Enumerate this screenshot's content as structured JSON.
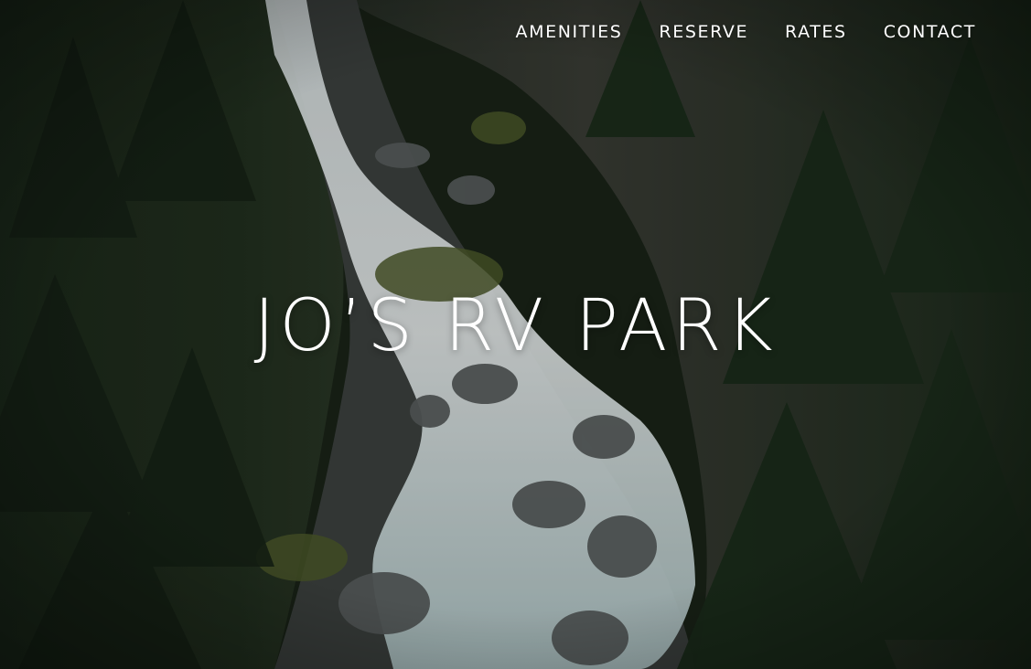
{
  "nav": {
    "items": [
      {
        "label": "AMENITIES"
      },
      {
        "label": "RESERVE"
      },
      {
        "label": "RATES"
      },
      {
        "label": "CONTACT"
      }
    ]
  },
  "hero": {
    "title": "JO’S RV PARK",
    "background": "aerial photo of a white-water river through dense evergreen forest"
  },
  "colors": {
    "text": "#ffffff",
    "forest_dark": "#1a2418",
    "forest_mid": "#2c3c26",
    "water": "#e9f2f3",
    "rock": "#55595a"
  }
}
